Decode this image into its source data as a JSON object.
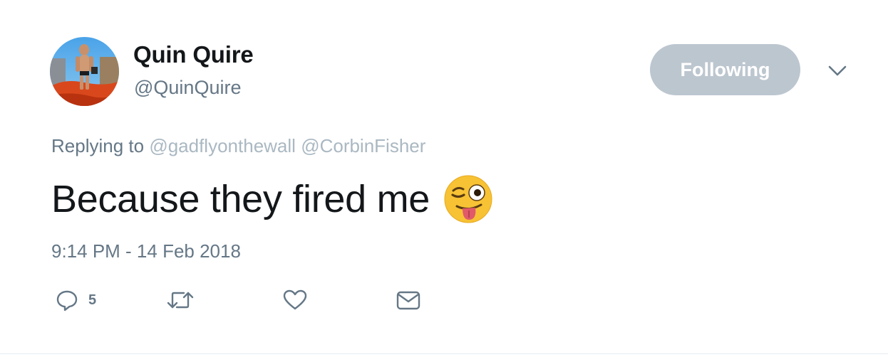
{
  "author": {
    "display_name": "Quin Quire",
    "handle": "@QuinQuire"
  },
  "follow_button": {
    "label": "Following"
  },
  "reply": {
    "prefix": "Replying to",
    "mentions": [
      "@gadflyonthewall",
      "@CorbinFisher"
    ]
  },
  "tweet": {
    "text": "Because they fired me",
    "emoji": "winking-face-with-tongue"
  },
  "timestamp": "9:14 PM - 14 Feb 2018",
  "actions": {
    "reply_count": "5",
    "icons": [
      "reply-icon",
      "retweet-icon",
      "like-icon",
      "direct-message-icon"
    ]
  },
  "colors": {
    "text": "#14171a",
    "secondary": "#657786",
    "mention": "#aab8c2",
    "follow_bg": "#bcc6cf"
  }
}
